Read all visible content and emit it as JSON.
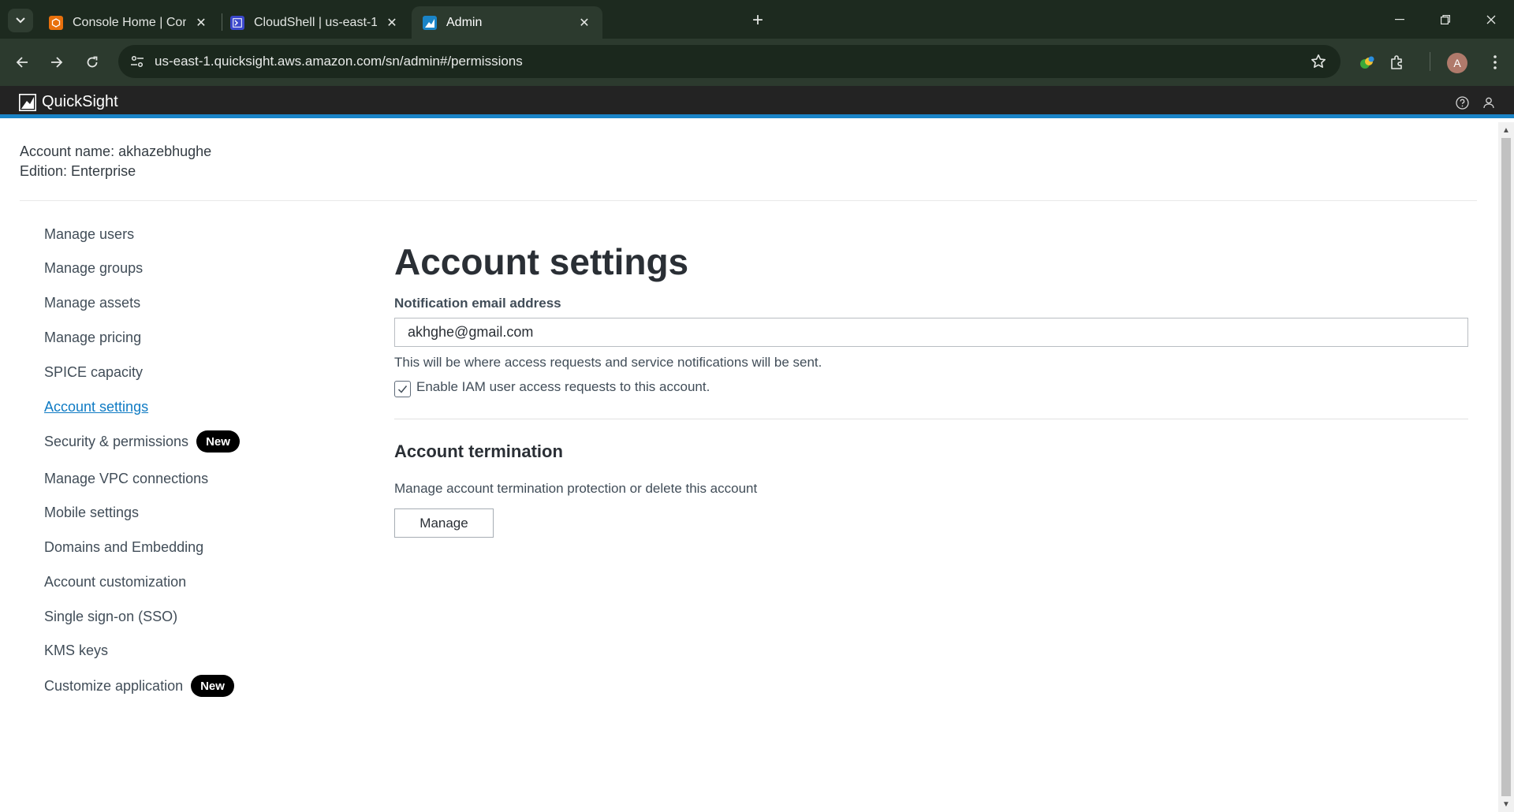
{
  "browser": {
    "tabs": [
      {
        "title": "Console Home | Console Home",
        "icon": "aws-console-icon",
        "active": false
      },
      {
        "title": "CloudShell | us-east-1",
        "icon": "cloudshell-icon",
        "active": false
      },
      {
        "title": "Admin",
        "icon": "quicksight-icon",
        "active": true
      }
    ],
    "url": "us-east-1.quicksight.aws.amazon.com/sn/admin#/permissions",
    "profile_initial": "A",
    "colors": {
      "tabbar": "#1d2a1f",
      "toolbar": "#2c3a2e"
    }
  },
  "app": {
    "brand": "QuickSight",
    "accent_color": "#1a84c7"
  },
  "account": {
    "name_line": "Account name: akhazebhughe",
    "edition_line": "Edition: Enterprise"
  },
  "sidebar": {
    "items": [
      {
        "label": "Manage users"
      },
      {
        "label": "Manage groups"
      },
      {
        "label": "Manage assets"
      },
      {
        "label": "Manage pricing"
      },
      {
        "label": "SPICE capacity"
      },
      {
        "label": "Account settings",
        "active": true
      },
      {
        "label": "Security & permissions",
        "badge": "New"
      },
      {
        "label": "Manage VPC connections"
      },
      {
        "label": "Mobile settings"
      },
      {
        "label": "Domains and Embedding"
      },
      {
        "label": "Account customization"
      },
      {
        "label": "Single sign-on (SSO)"
      },
      {
        "label": "KMS keys"
      },
      {
        "label": "Customize application",
        "badge": "New"
      }
    ]
  },
  "main": {
    "title": "Account settings",
    "email_label": "Notification email address",
    "email_value": "akhghe@gmail.com",
    "email_help": "This will be where access requests and service notifications will be sent.",
    "iam_checkbox_label": "Enable IAM user access requests to this account.",
    "iam_checkbox_checked": true,
    "termination_title": "Account termination",
    "termination_desc": "Manage account termination protection or delete this account",
    "manage_button": "Manage"
  }
}
